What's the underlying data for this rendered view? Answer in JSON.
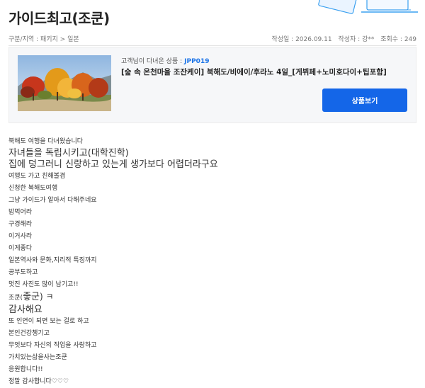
{
  "page": {
    "title": "가이드최고(조쿤)"
  },
  "breadcrumb": [
    "구분/지역",
    "패키지",
    "일본"
  ],
  "breadcrumb_separators": [
    ":",
    ">"
  ],
  "post_info": {
    "date": "작성일 : 2026.09.11",
    "author": "작성자 : 강**",
    "views": "조회수 : 249"
  },
  "product": {
    "visited_label": "고객님이 다녀온 상품 :",
    "code": "JPP019",
    "name": "[숲 속 온천마을 조잔케이] 북해도/비에이/후라노 4일_[게뷔페+노미호다이+팁포함]",
    "button_label": "상품보기",
    "thumbnail_icon": "autumn-trees-photo"
  },
  "review_lines": [
    {
      "text": "북해도 여행을 다녀왔습니다",
      "size": "sm"
    },
    {
      "text": "자녀들을 독립시키고(대학진학)",
      "size": "lg"
    },
    {
      "text": "집에 덩그러니 신랑하고 있는게 생가보다 어렵더라구요",
      "size": "lg"
    },
    {
      "text": "여행도 가고 친해볼겸",
      "size": "sm"
    },
    {
      "text": "신청한 북해도여행",
      "size": "sm"
    },
    {
      "text": "그냥 가이드가 알아서 다해주네요",
      "size": "sm"
    },
    {
      "text": "밥먹어라",
      "size": "sm"
    },
    {
      "text": "구경해라",
      "size": "sm"
    },
    {
      "text": "이거사라",
      "size": "sm"
    },
    {
      "text": "이게좋다",
      "size": "sm"
    },
    {
      "text": "일본역사와 문화,지리적 특징까지",
      "size": "sm"
    },
    {
      "text": "공부도하고",
      "size": "sm"
    },
    {
      "text": "멋진 사진도 많이 남기고!!",
      "size": "sm"
    },
    {
      "text": "조쿤(좋군) ㅋ",
      "size": "mixed",
      "parts": [
        "조쿤(",
        "좋군",
        ") ㅋ"
      ]
    },
    {
      "text": "감사해요",
      "size": "lg"
    },
    {
      "text": "또 인연이 되면 보는 걸로 하고",
      "size": "sm"
    },
    {
      "text": "본인건강챙기고",
      "size": "sm"
    },
    {
      "text": "무엇보다 자신의 직업을 사랑하고",
      "size": "sm"
    },
    {
      "text": "가치있는삶을사는조쿤",
      "size": "sm"
    },
    {
      "text": "응원합니다!!",
      "size": "sm"
    },
    {
      "text": "정말 감사합니다♡♡♡",
      "size": "sm"
    }
  ],
  "colors": {
    "accent": "#1466e8",
    "product_code": "#1a73e8",
    "box_background": "#f6f7f9"
  }
}
